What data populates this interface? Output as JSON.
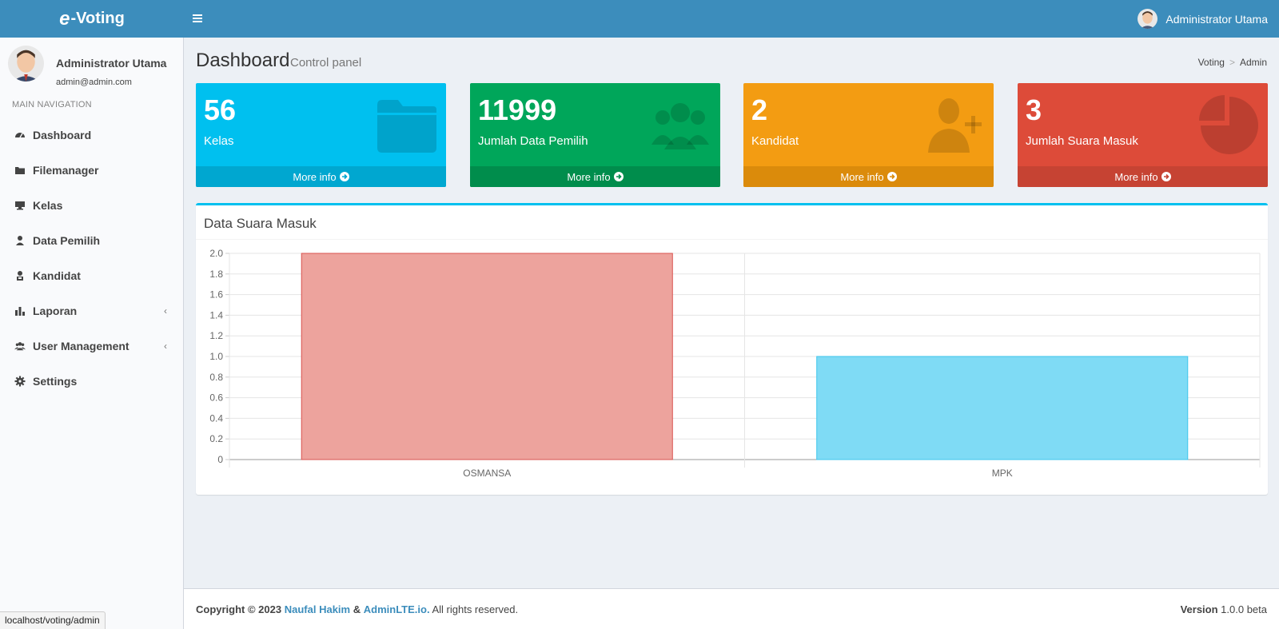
{
  "app": {
    "logo_prefix": "e",
    "logo_text": "-Voting"
  },
  "topbar": {
    "menu_icon": "hamburger-icon",
    "user_name": "Administrator Utama"
  },
  "sidebar": {
    "user": {
      "name": "Administrator Utama",
      "email": "admin@admin.com"
    },
    "nav_header": "MAIN NAVIGATION",
    "items": [
      {
        "label": "Dashboard",
        "icon": "dashboard-icon"
      },
      {
        "label": "Filemanager",
        "icon": "folder-icon"
      },
      {
        "label": "Kelas",
        "icon": "desk-icon"
      },
      {
        "label": "Data Pemilih",
        "icon": "user-icon"
      },
      {
        "label": "Kandidat",
        "icon": "candidate-icon"
      },
      {
        "label": "Laporan",
        "icon": "bar-chart-icon",
        "expandable": true
      },
      {
        "label": "User Management",
        "icon": "users-icon",
        "expandable": true
      },
      {
        "label": "Settings",
        "icon": "gear-icon"
      }
    ]
  },
  "content": {
    "title": "Dashboard",
    "subtitle": "Control panel",
    "breadcrumb": [
      "Voting",
      "Admin"
    ]
  },
  "boxes": [
    {
      "value": "56",
      "label": "Kelas",
      "footer": "More info",
      "color": "#00c0ef",
      "icon": "folder-icon"
    },
    {
      "value": "11999",
      "label": "Jumlah Data Pemilih",
      "footer": "More info",
      "color": "#00a65a",
      "icon": "users-icon"
    },
    {
      "value": "2",
      "label": "Kandidat",
      "footer": "More info",
      "color": "#f39c12",
      "icon": "user-plus-icon"
    },
    {
      "value": "3",
      "label": "Jumlah Suara Masuk",
      "footer": "More info",
      "color": "#dd4b39",
      "icon": "pie-chart-icon"
    }
  ],
  "chart_box": {
    "title": "Data Suara Masuk"
  },
  "chart_data": {
    "type": "bar",
    "categories": [
      "OSMANSA",
      "MPK"
    ],
    "values": [
      2,
      1
    ],
    "colors": [
      "#eda39d",
      "#7fdbf5"
    ],
    "border_colors": [
      "#d9534f",
      "#3fc6ec"
    ],
    "ylim": [
      0,
      2
    ],
    "yticks": [
      "0",
      "0.2",
      "0.4",
      "0.6",
      "0.8",
      "1.0",
      "1.2",
      "1.4",
      "1.6",
      "1.8",
      "2.0"
    ],
    "grid": true
  },
  "footer": {
    "copy_prefix": "Copyright © 2023",
    "author": "Naufal Hakim",
    "amp": "&",
    "framework": "AdminLTE.io.",
    "rights": "All rights reserved.",
    "version_label": "Version",
    "version_value": "1.0.0 beta"
  },
  "status_url": "localhost/voting/admin"
}
